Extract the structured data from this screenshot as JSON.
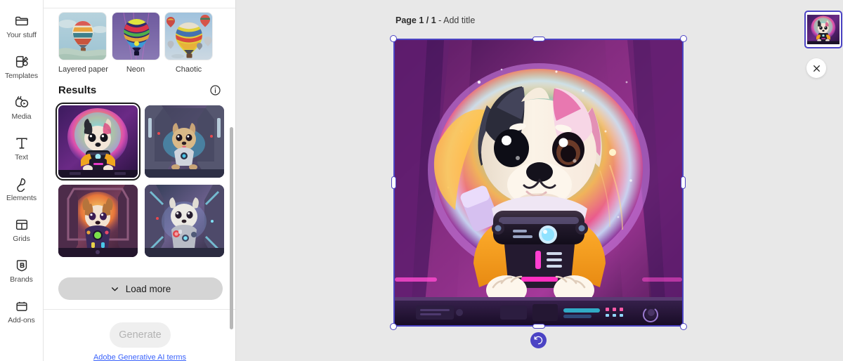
{
  "rail": {
    "items": [
      {
        "label": "Your stuff",
        "icon": "folder-icon"
      },
      {
        "label": "Templates",
        "icon": "templates-icon"
      },
      {
        "label": "Media",
        "icon": "media-icon"
      },
      {
        "label": "Text",
        "icon": "text-icon"
      },
      {
        "label": "Elements",
        "icon": "elements-icon"
      },
      {
        "label": "Grids",
        "icon": "grids-icon"
      },
      {
        "label": "Brands",
        "icon": "brands-icon"
      },
      {
        "label": "Add-ons",
        "icon": "addons-icon"
      }
    ]
  },
  "panel": {
    "styles": [
      {
        "label": "Layered paper",
        "selected": false
      },
      {
        "label": "Neon",
        "selected": false
      },
      {
        "label": "Chaotic",
        "selected": false
      }
    ],
    "results": {
      "title": "Results",
      "info_icon": "info-icon",
      "items": [
        {
          "alt": "astronaut puppy in spaceship window, purple neon",
          "selected": true
        },
        {
          "alt": "golden puppy in spaceship corridor",
          "selected": false
        },
        {
          "alt": "brown and white puppy in cockpit with green orb",
          "selected": false
        },
        {
          "alt": "white fluffy puppy in spacesuit",
          "selected": false
        }
      ]
    },
    "load_more": {
      "label": "Load more",
      "icon": "chevron-down-icon"
    },
    "generate": {
      "label": "Generate",
      "disabled": true
    },
    "terms_link": "Adobe Generative AI terms"
  },
  "canvas": {
    "page_number": "Page 1 / 1",
    "separator": " - ",
    "add_title": "Add title",
    "artwork_alt": "Cute astronaut puppy inside a spaceship looking out of a round window",
    "refresh_icon": "refresh-undo-icon"
  },
  "pages_rail": {
    "thumbnail_alt": "Page 1 thumbnail",
    "close_icon": "close-icon"
  },
  "colors": {
    "accent": "#4b43c4",
    "link": "#3b63fb",
    "canvas_bg": "#e8e8e8",
    "panel_bg": "#ffffff"
  }
}
